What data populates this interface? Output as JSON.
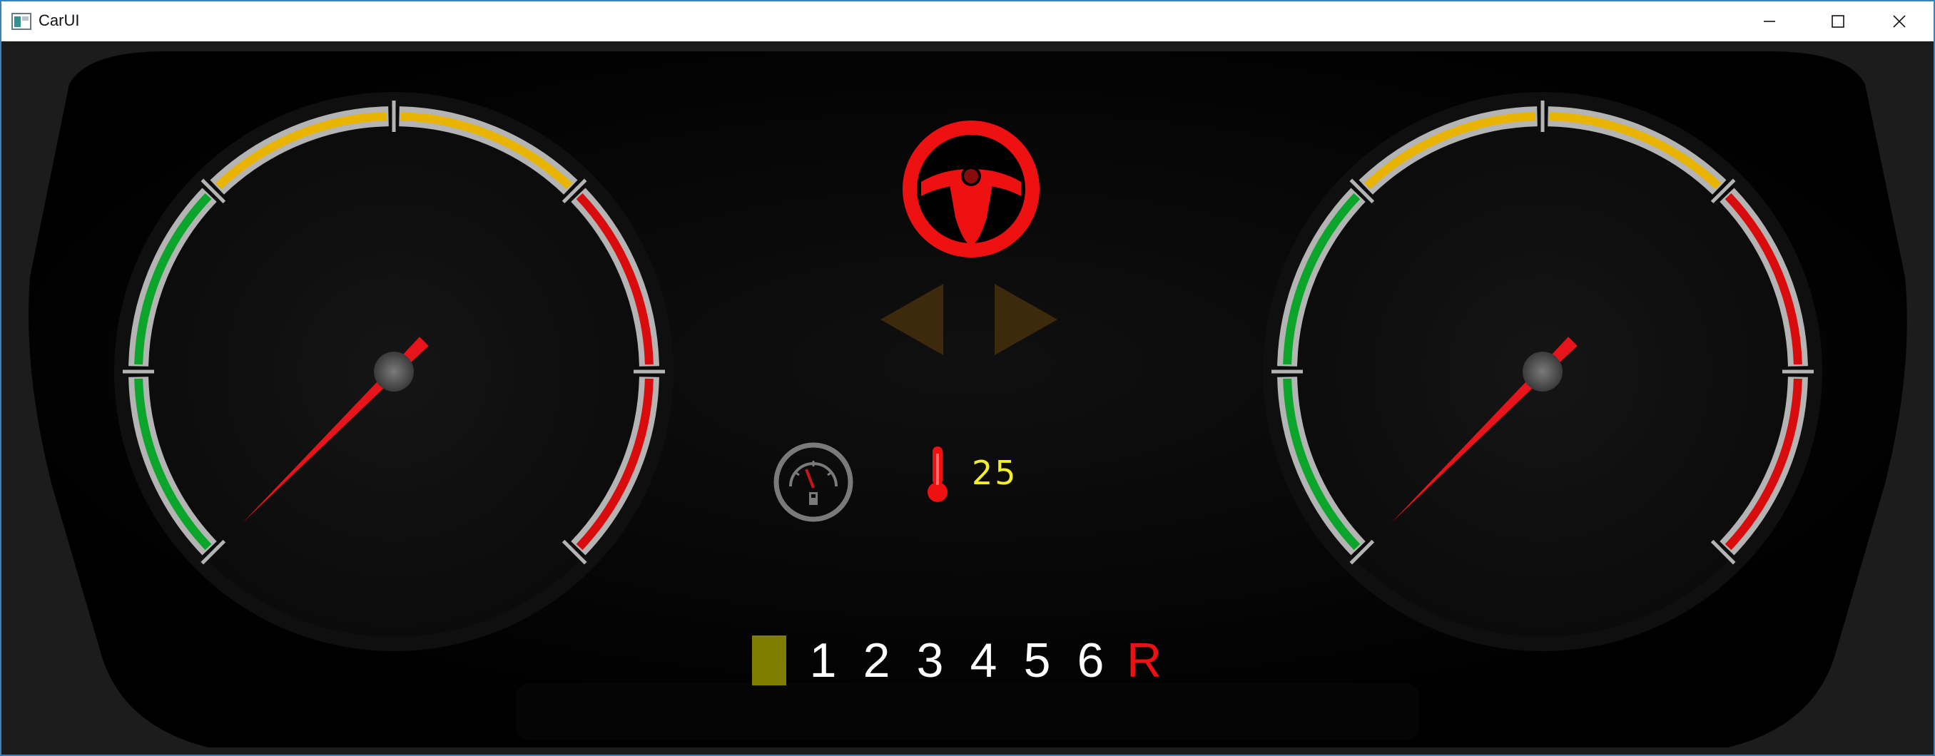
{
  "window": {
    "title": "CarUI",
    "controls": [
      "minimize-icon",
      "maximize-icon",
      "close-icon"
    ]
  },
  "gauges": [
    {
      "name": "left-gauge",
      "needle_level": 0.0,
      "zones": [
        "green",
        "yellow",
        "red"
      ]
    },
    {
      "name": "right-gauge",
      "needle_level": 0.0,
      "zones": [
        "green",
        "yellow",
        "red"
      ]
    }
  ],
  "indicators": {
    "steering_warning_icon": "steering-wheel-icon",
    "steering_warning_color": "#e8141b",
    "turn_signals": [
      "turn-left-icon",
      "turn-right-icon"
    ],
    "turn_signal_color": "#3d2a0c",
    "fuel_icon": "fuel-gauge-icon",
    "temperature_icon": "thermometer-icon",
    "temperature_value": "25"
  },
  "gearbox": {
    "gears": [
      "1",
      "2",
      "3",
      "4",
      "5",
      "6"
    ],
    "reverse": "R",
    "indicator_color": "#7f7d00"
  },
  "colors": {
    "green": "#0aa52a",
    "yellow": "#e8b400",
    "red": "#d80c0c",
    "needle": "#e8141b",
    "temperature_text": "#f2ee2a"
  }
}
